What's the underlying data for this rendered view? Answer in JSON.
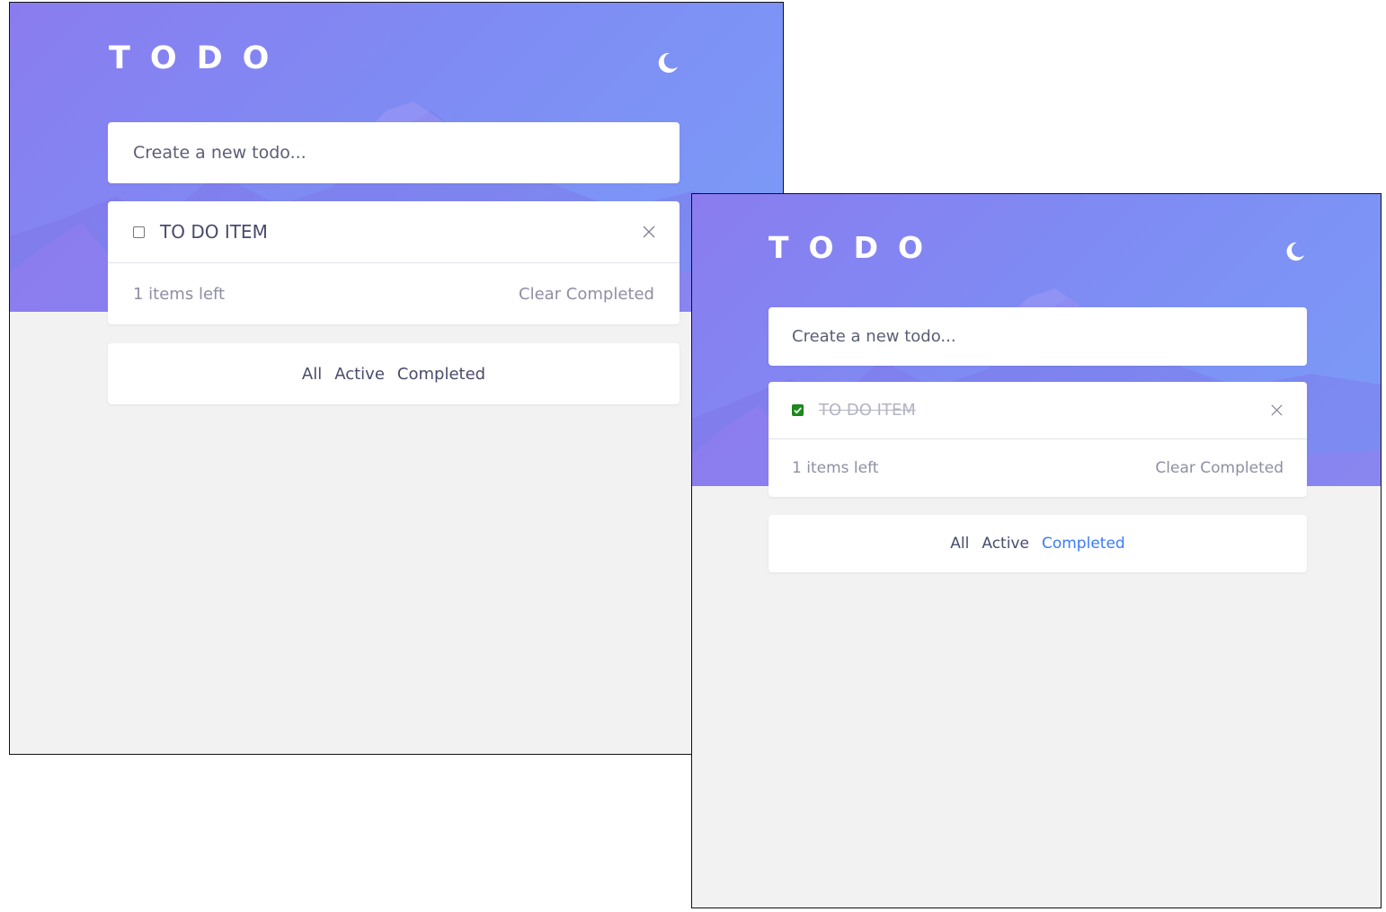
{
  "windows": [
    {
      "app_title": "TODO",
      "theme_toggle": "moon-icon",
      "new_todo": {
        "placeholder": "Create a new todo..."
      },
      "todos": [
        {
          "text": "TO DO ITEM",
          "completed": false
        }
      ],
      "footer": {
        "items_left": "1 items left",
        "clear_label": "Clear Completed"
      },
      "filters": [
        {
          "label": "All",
          "active": false
        },
        {
          "label": "Active",
          "active": false
        },
        {
          "label": "Completed",
          "active": false
        }
      ]
    },
    {
      "app_title": "TODO",
      "theme_toggle": "moon-icon",
      "new_todo": {
        "placeholder": "Create a new todo..."
      },
      "todos": [
        {
          "text": "TO DO ITEM",
          "completed": true
        }
      ],
      "footer": {
        "items_left": "1 items left",
        "clear_label": "Clear Completed"
      },
      "filters": [
        {
          "label": "All",
          "active": false
        },
        {
          "label": "Active",
          "active": false
        },
        {
          "label": "Completed",
          "active": true
        }
      ]
    }
  ],
  "colors": {
    "hero_gradient_start": "#8a7cf0",
    "hero_gradient_end": "#7b9cf8",
    "page_background": "#f2f2f2",
    "card_background": "#ffffff",
    "text_primary": "#494c6b",
    "text_muted": "#8e8fa3",
    "text_completed": "#b3b4c2",
    "active_filter": "#3a7bfd",
    "checkbox_checked": "#1e8a1e"
  }
}
